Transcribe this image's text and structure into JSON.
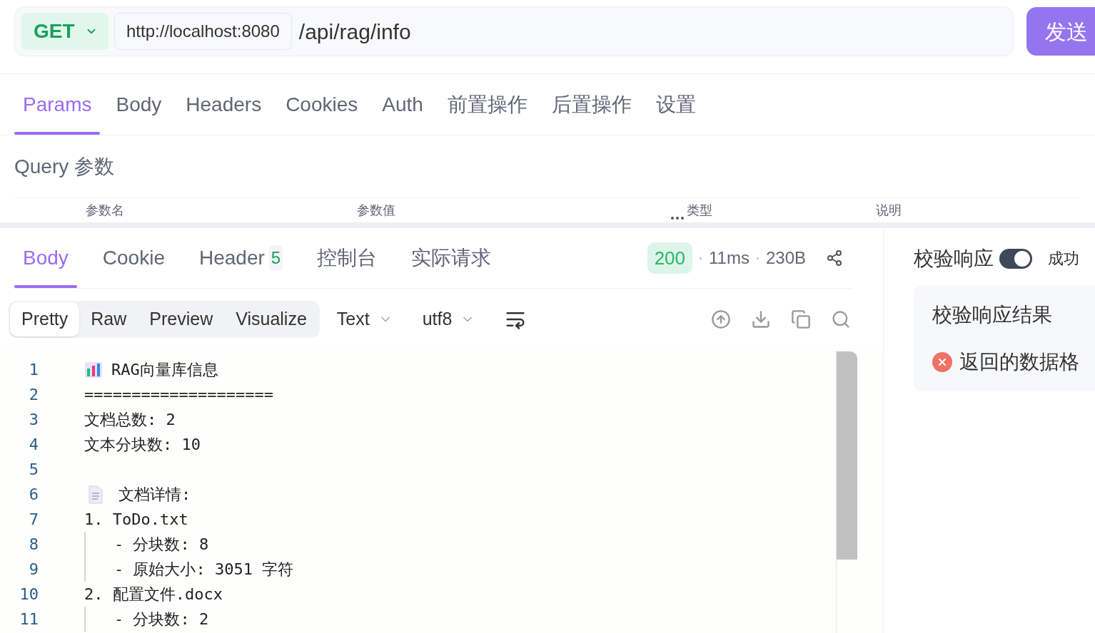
{
  "request": {
    "method": "GET",
    "base_url": "http://localhost:8080",
    "path": "/api/rag/info",
    "send_label": "发送"
  },
  "request_tabs": [
    {
      "label": "Params",
      "selected": true
    },
    {
      "label": "Body",
      "selected": false
    },
    {
      "label": "Headers",
      "selected": false
    },
    {
      "label": "Cookies",
      "selected": false
    },
    {
      "label": "Auth",
      "selected": false
    },
    {
      "label": "前置操作",
      "selected": false
    },
    {
      "label": "后置操作",
      "selected": false
    },
    {
      "label": "设置",
      "selected": false
    }
  ],
  "query": {
    "title": "Query 参数",
    "columns": [
      "参数名",
      "参数值",
      "类型",
      "说明"
    ]
  },
  "response_tabs": [
    {
      "label": "Body",
      "selected": true
    },
    {
      "label": "Cookie",
      "selected": false
    },
    {
      "label": "Header",
      "count": "5",
      "selected": false
    },
    {
      "label": "控制台",
      "selected": false
    },
    {
      "label": "实际请求",
      "selected": false
    }
  ],
  "status": {
    "code": "200",
    "time": "11ms",
    "size": "230B"
  },
  "formats": [
    {
      "label": "Pretty",
      "selected": true
    },
    {
      "label": "Raw",
      "selected": false
    },
    {
      "label": "Preview",
      "selected": false
    },
    {
      "label": "Visualize",
      "selected": false
    }
  ],
  "content_type": "Text",
  "encoding": "utf8",
  "code_lines": [
    {
      "number": "1",
      "kind": "chart",
      "text": "RAG向量库信息"
    },
    {
      "number": "2",
      "text": "===================="
    },
    {
      "number": "3",
      "text": "文档总数: 2"
    },
    {
      "number": "4",
      "text": "文本分块数: 10"
    },
    {
      "number": "5"
    },
    {
      "number": "6",
      "kind": "document",
      "text": "文档详情:"
    },
    {
      "number": "7",
      "text": "1. ToDo.txt",
      "children": [
        {
          "number": "8",
          "text": "- 分块数: 8"
        },
        {
          "number": "9",
          "text": "- 原始大小: 3051 字符"
        }
      ]
    },
    {
      "number": "10",
      "text": "2. 配置文件.docx",
      "children": [
        {
          "number": "11",
          "text": "- 分块数: 2"
        }
      ]
    }
  ],
  "validation": {
    "label": "校验响应",
    "on": true,
    "result_label": "成功",
    "card_title": "校验响应结果",
    "message": "返回的数据格",
    "passed": false
  }
}
